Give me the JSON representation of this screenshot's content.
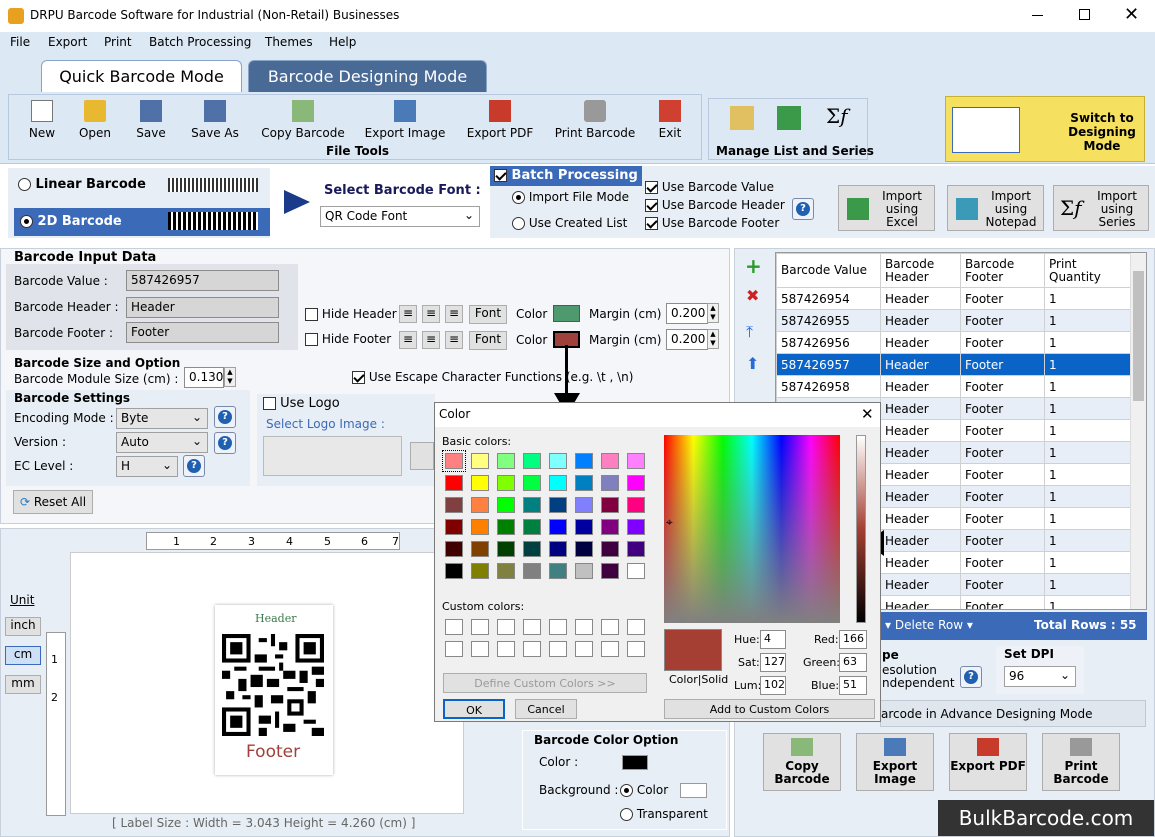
{
  "window": {
    "title": "DRPU Barcode Software for Industrial (Non-Retail) Businesses"
  },
  "menu": [
    "File",
    "Export",
    "Print",
    "Batch Processing",
    "Themes",
    "Help"
  ],
  "modes": {
    "quick": "Quick Barcode Mode",
    "designing": "Barcode Designing Mode"
  },
  "toolbar": {
    "buttons": [
      "New",
      "Open",
      "Save",
      "Save As",
      "Copy Barcode",
      "Export Image",
      "Export PDF",
      "Print Barcode",
      "Exit"
    ],
    "group_label": "File Tools",
    "manage_label": "Manage List and Series",
    "switch_label": "Switch to Designing Mode"
  },
  "barcode_type": {
    "linear": "Linear Barcode",
    "twod": "2D Barcode",
    "font_label": "Select Barcode Font :",
    "font_value": "QR Code Font"
  },
  "batch": {
    "title": "Batch Processing",
    "import_file": "Import File Mode",
    "use_created": "Use Created List",
    "use_value": "Use Barcode Value",
    "use_header": "Use Barcode Header",
    "use_footer": "Use Barcode Footer",
    "import_excel": "Import using Excel",
    "import_notepad": "Import using Notepad",
    "import_series": "Import using Series"
  },
  "input": {
    "section": "Barcode Input Data",
    "value_label": "Barcode Value :",
    "value": "587426957",
    "header_label": "Barcode Header :",
    "header": "Header",
    "footer_label": "Barcode Footer :",
    "footer": "Footer",
    "hide_header": "Hide Header",
    "hide_footer": "Hide Footer",
    "font": "Font",
    "color": "Color",
    "margin_label": "Margin (cm)",
    "margin_header": "0.200",
    "margin_footer": "0.200",
    "header_color": "#4e9a6e",
    "footer_color": "#a0403a"
  },
  "size": {
    "section": "Barcode Size and Option",
    "module_label": "Barcode Module Size (cm) :",
    "module_value": "0.130",
    "escape": "Use Escape Character Functions (e.g. \\t , \\n)"
  },
  "settings": {
    "section": "Barcode Settings",
    "encoding_label": "Encoding Mode :",
    "encoding": "Byte",
    "version_label": "Version :",
    "version": "Auto",
    "ec_label": "EC Level :",
    "ec": "H",
    "reset": "Reset All",
    "use_logo": "Use Logo",
    "select_logo": "Select Logo Image :"
  },
  "units": {
    "label": "Unit",
    "inch": "inch",
    "cm": "cm",
    "mm": "mm"
  },
  "ruler": [
    "1",
    "2",
    "3",
    "4",
    "5",
    "6",
    "7"
  ],
  "ruler_v": [
    "1",
    "2"
  ],
  "preview": {
    "header": "Header",
    "footer": "Footer",
    "status": "[ Label Size : Width = 3.043  Height = 4.260 (cm) ]"
  },
  "color_option": {
    "section": "Barcode Color Option",
    "color_label": "Color :",
    "background_label": "Background :",
    "color": "Color",
    "transparent": "Transparent"
  },
  "table": {
    "headers": [
      "Barcode Value",
      "Barcode Header",
      "Barcode Footer",
      "Print Quantity"
    ],
    "rows": [
      [
        "587426954",
        "Header",
        "Footer",
        "1"
      ],
      [
        "587426955",
        "Header",
        "Footer",
        "1"
      ],
      [
        "587426956",
        "Header",
        "Footer",
        "1"
      ],
      [
        "587426957",
        "Header",
        "Footer",
        "1"
      ],
      [
        "587426958",
        "Header",
        "Footer",
        "1"
      ],
      [
        "",
        "Header",
        "Footer",
        "1"
      ],
      [
        "",
        "Header",
        "Footer",
        "1"
      ],
      [
        "",
        "Header",
        "Footer",
        "1"
      ],
      [
        "",
        "Header",
        "Footer",
        "1"
      ],
      [
        "",
        "Header",
        "Footer",
        "1"
      ],
      [
        "",
        "Header",
        "Footer",
        "1"
      ],
      [
        "",
        "Header",
        "Footer",
        "1"
      ],
      [
        "",
        "Header",
        "Footer",
        "1"
      ],
      [
        "",
        "Header",
        "Footer",
        "1"
      ],
      [
        "",
        "Header",
        "Footer",
        "1"
      ]
    ],
    "delete_row": "Delete Row",
    "total_rows": "Total Rows : 55"
  },
  "dpi": {
    "type_partial": "pe",
    "resolution": "esolution",
    "independent": "ndependent",
    "set_dpi": "Set DPI",
    "value": "96",
    "advance": "arcode in Advance Designing Mode"
  },
  "bottom_buttons": [
    "Copy Barcode",
    "Export Image",
    "Export PDF",
    "Print Barcode"
  ],
  "watermark": "BulkBarcode.com",
  "dialog": {
    "title": "Color",
    "basic": "Basic colors:",
    "custom": "Custom colors:",
    "define": "Define Custom Colors >>",
    "ok": "OK",
    "cancel": "Cancel",
    "add": "Add to Custom Colors",
    "colorsolid": "Color|Solid",
    "hue_label": "Hue:",
    "hue": "4",
    "sat_label": "Sat:",
    "sat": "127",
    "lum_label": "Lum:",
    "lum": "102",
    "red_label": "Red:",
    "red": "166",
    "green_label": "Green:",
    "green": "63",
    "blue_label": "Blue:",
    "blue": "51",
    "current": "#a63f33",
    "basic_colors": [
      "#ff8080",
      "#ffff80",
      "#80ff80",
      "#00ff80",
      "#80ffff",
      "#0080ff",
      "#ff80c0",
      "#ff80ff",
      "#ff0000",
      "#ffff00",
      "#80ff00",
      "#00ff40",
      "#00ffff",
      "#0080c0",
      "#8080c0",
      "#ff00ff",
      "#804040",
      "#ff8040",
      "#00ff00",
      "#008080",
      "#004080",
      "#8080ff",
      "#800040",
      "#ff0080",
      "#800000",
      "#ff8000",
      "#008000",
      "#008040",
      "#0000ff",
      "#0000a0",
      "#800080",
      "#8000ff",
      "#400000",
      "#804000",
      "#004000",
      "#004040",
      "#000080",
      "#000040",
      "#400040",
      "#400080",
      "#000000",
      "#808000",
      "#808040",
      "#808080",
      "#408080",
      "#c0c0c0",
      "#400040",
      "#ffffff"
    ]
  }
}
